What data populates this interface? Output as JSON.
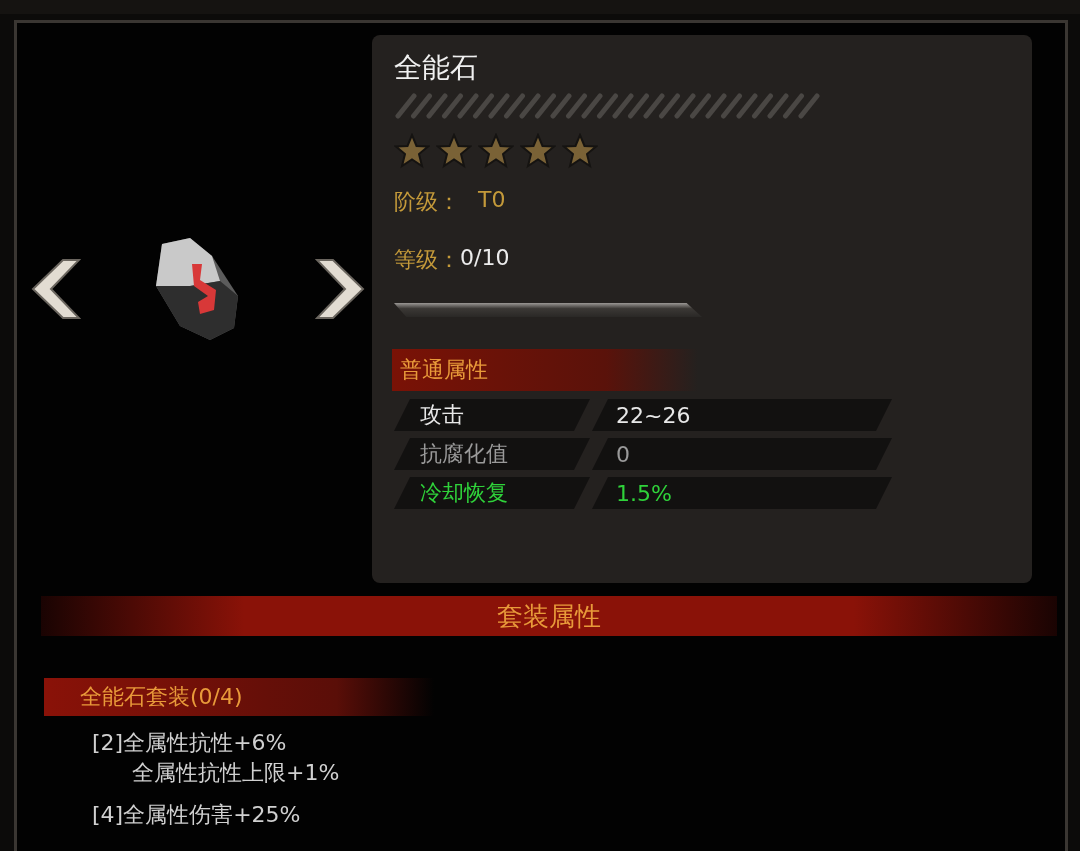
{
  "item": {
    "name": "全能石",
    "stars": 5,
    "tier_label": "阶级：",
    "tier_value": "T0",
    "level_label": "等级：",
    "level_value": "0/10",
    "level": 0
  },
  "basic_attributes": {
    "title": "普通属性",
    "rows": [
      {
        "name": "攻击",
        "value": "22~26",
        "color": "#e8e8e8"
      },
      {
        "name": "抗腐化值",
        "value": "0",
        "color": "#9a9a9a"
      },
      {
        "name": "冷却恢复",
        "value": "1.5%",
        "color": "#2fd23a"
      }
    ]
  },
  "set_section": {
    "title": "套装属性",
    "set_name": "全能石套装(0/4)",
    "bonuses": [
      {
        "lines": [
          "[2]全属性抗性+6%",
          "全属性抗性上限+1%"
        ]
      },
      {
        "lines": [
          "[4]全属性伤害+25%"
        ]
      }
    ]
  }
}
